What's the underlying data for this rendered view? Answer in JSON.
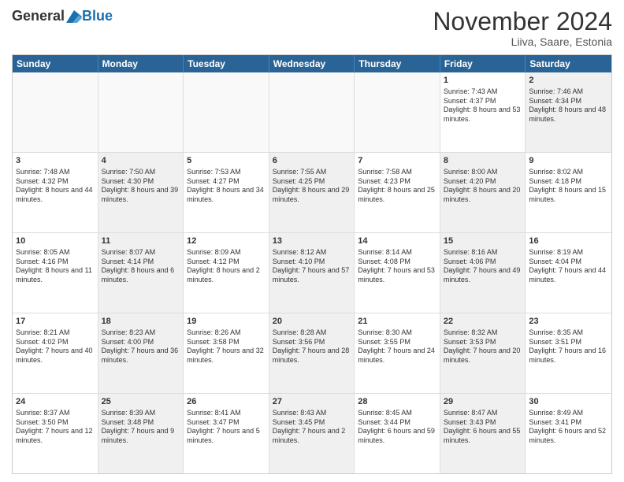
{
  "logo": {
    "general": "General",
    "blue": "Blue"
  },
  "title": "November 2024",
  "location": "Liiva, Saare, Estonia",
  "weekdays": [
    "Sunday",
    "Monday",
    "Tuesday",
    "Wednesday",
    "Thursday",
    "Friday",
    "Saturday"
  ],
  "rows": [
    [
      {
        "day": "",
        "info": "",
        "empty": true
      },
      {
        "day": "",
        "info": "",
        "empty": true
      },
      {
        "day": "",
        "info": "",
        "empty": true
      },
      {
        "day": "",
        "info": "",
        "empty": true
      },
      {
        "day": "",
        "info": "",
        "empty": true
      },
      {
        "day": "1",
        "info": "Sunrise: 7:43 AM\nSunset: 4:37 PM\nDaylight: 8 hours and 53 minutes.",
        "empty": false
      },
      {
        "day": "2",
        "info": "Sunrise: 7:46 AM\nSunset: 4:34 PM\nDaylight: 8 hours and 48 minutes.",
        "empty": false,
        "shaded": true
      }
    ],
    [
      {
        "day": "3",
        "info": "Sunrise: 7:48 AM\nSunset: 4:32 PM\nDaylight: 8 hours and 44 minutes.",
        "empty": false
      },
      {
        "day": "4",
        "info": "Sunrise: 7:50 AM\nSunset: 4:30 PM\nDaylight: 8 hours and 39 minutes.",
        "empty": false,
        "shaded": true
      },
      {
        "day": "5",
        "info": "Sunrise: 7:53 AM\nSunset: 4:27 PM\nDaylight: 8 hours and 34 minutes.",
        "empty": false
      },
      {
        "day": "6",
        "info": "Sunrise: 7:55 AM\nSunset: 4:25 PM\nDaylight: 8 hours and 29 minutes.",
        "empty": false,
        "shaded": true
      },
      {
        "day": "7",
        "info": "Sunrise: 7:58 AM\nSunset: 4:23 PM\nDaylight: 8 hours and 25 minutes.",
        "empty": false
      },
      {
        "day": "8",
        "info": "Sunrise: 8:00 AM\nSunset: 4:20 PM\nDaylight: 8 hours and 20 minutes.",
        "empty": false,
        "shaded": true
      },
      {
        "day": "9",
        "info": "Sunrise: 8:02 AM\nSunset: 4:18 PM\nDaylight: 8 hours and 15 minutes.",
        "empty": false
      }
    ],
    [
      {
        "day": "10",
        "info": "Sunrise: 8:05 AM\nSunset: 4:16 PM\nDaylight: 8 hours and 11 minutes.",
        "empty": false
      },
      {
        "day": "11",
        "info": "Sunrise: 8:07 AM\nSunset: 4:14 PM\nDaylight: 8 hours and 6 minutes.",
        "empty": false,
        "shaded": true
      },
      {
        "day": "12",
        "info": "Sunrise: 8:09 AM\nSunset: 4:12 PM\nDaylight: 8 hours and 2 minutes.",
        "empty": false
      },
      {
        "day": "13",
        "info": "Sunrise: 8:12 AM\nSunset: 4:10 PM\nDaylight: 7 hours and 57 minutes.",
        "empty": false,
        "shaded": true
      },
      {
        "day": "14",
        "info": "Sunrise: 8:14 AM\nSunset: 4:08 PM\nDaylight: 7 hours and 53 minutes.",
        "empty": false
      },
      {
        "day": "15",
        "info": "Sunrise: 8:16 AM\nSunset: 4:06 PM\nDaylight: 7 hours and 49 minutes.",
        "empty": false,
        "shaded": true
      },
      {
        "day": "16",
        "info": "Sunrise: 8:19 AM\nSunset: 4:04 PM\nDaylight: 7 hours and 44 minutes.",
        "empty": false
      }
    ],
    [
      {
        "day": "17",
        "info": "Sunrise: 8:21 AM\nSunset: 4:02 PM\nDaylight: 7 hours and 40 minutes.",
        "empty": false
      },
      {
        "day": "18",
        "info": "Sunrise: 8:23 AM\nSunset: 4:00 PM\nDaylight: 7 hours and 36 minutes.",
        "empty": false,
        "shaded": true
      },
      {
        "day": "19",
        "info": "Sunrise: 8:26 AM\nSunset: 3:58 PM\nDaylight: 7 hours and 32 minutes.",
        "empty": false
      },
      {
        "day": "20",
        "info": "Sunrise: 8:28 AM\nSunset: 3:56 PM\nDaylight: 7 hours and 28 minutes.",
        "empty": false,
        "shaded": true
      },
      {
        "day": "21",
        "info": "Sunrise: 8:30 AM\nSunset: 3:55 PM\nDaylight: 7 hours and 24 minutes.",
        "empty": false
      },
      {
        "day": "22",
        "info": "Sunrise: 8:32 AM\nSunset: 3:53 PM\nDaylight: 7 hours and 20 minutes.",
        "empty": false,
        "shaded": true
      },
      {
        "day": "23",
        "info": "Sunrise: 8:35 AM\nSunset: 3:51 PM\nDaylight: 7 hours and 16 minutes.",
        "empty": false
      }
    ],
    [
      {
        "day": "24",
        "info": "Sunrise: 8:37 AM\nSunset: 3:50 PM\nDaylight: 7 hours and 12 minutes.",
        "empty": false
      },
      {
        "day": "25",
        "info": "Sunrise: 8:39 AM\nSunset: 3:48 PM\nDaylight: 7 hours and 9 minutes.",
        "empty": false,
        "shaded": true
      },
      {
        "day": "26",
        "info": "Sunrise: 8:41 AM\nSunset: 3:47 PM\nDaylight: 7 hours and 5 minutes.",
        "empty": false
      },
      {
        "day": "27",
        "info": "Sunrise: 8:43 AM\nSunset: 3:45 PM\nDaylight: 7 hours and 2 minutes.",
        "empty": false,
        "shaded": true
      },
      {
        "day": "28",
        "info": "Sunrise: 8:45 AM\nSunset: 3:44 PM\nDaylight: 6 hours and 59 minutes.",
        "empty": false
      },
      {
        "day": "29",
        "info": "Sunrise: 8:47 AM\nSunset: 3:43 PM\nDaylight: 6 hours and 55 minutes.",
        "empty": false,
        "shaded": true
      },
      {
        "day": "30",
        "info": "Sunrise: 8:49 AM\nSunset: 3:41 PM\nDaylight: 6 hours and 52 minutes.",
        "empty": false
      }
    ]
  ]
}
